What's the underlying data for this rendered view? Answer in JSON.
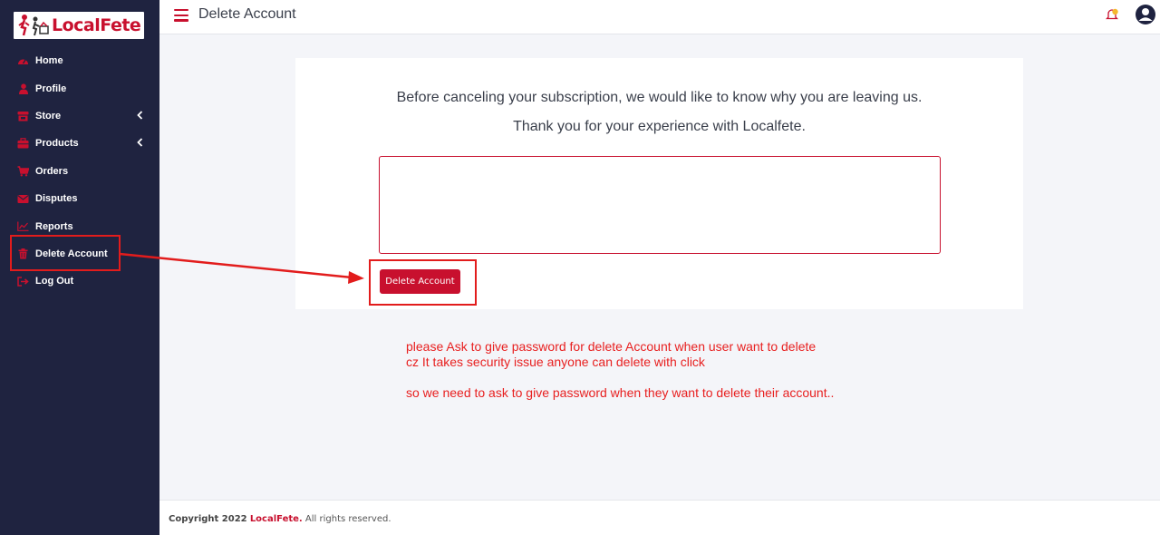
{
  "brand": {
    "name": "LocalFete",
    "accent": "#c8102e",
    "sidebar_bg": "#1f2340"
  },
  "sidebar": {
    "items": [
      {
        "label": "Home",
        "icon": "dashboard-icon"
      },
      {
        "label": "Profile",
        "icon": "user-icon"
      },
      {
        "label": "Store",
        "icon": "store-icon",
        "expandable": true
      },
      {
        "label": "Products",
        "icon": "briefcase-icon",
        "expandable": true
      },
      {
        "label": "Orders",
        "icon": "cart-icon"
      },
      {
        "label": "Disputes",
        "icon": "envelope-icon"
      },
      {
        "label": "Reports",
        "icon": "chart-icon"
      },
      {
        "label": "Delete Account",
        "icon": "trash-icon"
      },
      {
        "label": "Log Out",
        "icon": "logout-icon"
      }
    ]
  },
  "header": {
    "title": "Delete Account",
    "notification_icon": "bell-icon",
    "account_icon": "user-circle-icon"
  },
  "main": {
    "message_line1": "Before canceling your subscription, we would like to know why you are leaving us.",
    "message_line2": "Thank you for your experience with Localfete.",
    "textarea_value": "",
    "delete_button": "Delete Account"
  },
  "annotation": {
    "line1": "please Ask to give password for delete Account when user want to delete",
    "line2": "cz It takes security issue anyone can delete with click",
    "line3": "so we need to ask to give password when they want to delete their account..",
    "color": "#e82020"
  },
  "footer": {
    "prefix": "Copyright 2022",
    "brand": "LocalFete.",
    "suffix": "All rights reserved."
  }
}
